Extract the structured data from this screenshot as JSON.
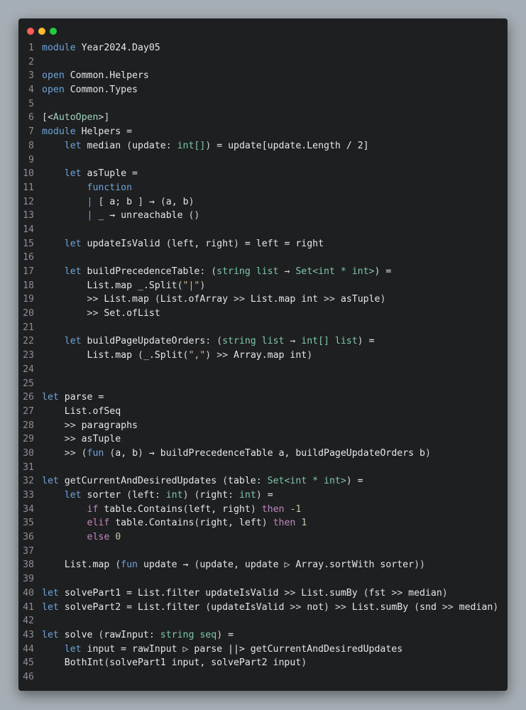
{
  "window": {
    "controls": [
      "close",
      "minimize",
      "zoom"
    ],
    "colors": {
      "background": "#1e1f21",
      "keyword": "#6fa3d8",
      "type": "#7fc8a9",
      "string": "#d8b486",
      "control": "#c586c0"
    }
  },
  "code": {
    "language": "fsharp",
    "lines": [
      [
        [
          "kw",
          "module"
        ],
        [
          "id",
          " Year2024.Day05"
        ]
      ],
      [],
      [
        [
          "kw",
          "open"
        ],
        [
          "id",
          " Common.Helpers"
        ]
      ],
      [
        [
          "kw",
          "open"
        ],
        [
          "id",
          " Common.Types"
        ]
      ],
      [],
      [
        [
          "op",
          "[<"
        ],
        [
          "at",
          "AutoOpen"
        ],
        [
          "op",
          ">]"
        ]
      ],
      [
        [
          "kw",
          "module"
        ],
        [
          "id",
          " Helpers ="
        ]
      ],
      [
        [
          "id",
          "    "
        ],
        [
          "kw",
          "let"
        ],
        [
          "id",
          " median "
        ],
        [
          "op",
          "("
        ],
        [
          "id",
          "update"
        ],
        [
          "op",
          ": "
        ],
        [
          "ty",
          "int[]"
        ],
        [
          "op",
          ")"
        ],
        [
          "id",
          " = update[update.Length / 2]"
        ]
      ],
      [],
      [
        [
          "id",
          "    "
        ],
        [
          "kw",
          "let"
        ],
        [
          "id",
          " asTuple ="
        ]
      ],
      [
        [
          "id",
          "        "
        ],
        [
          "kw",
          "function"
        ]
      ],
      [
        [
          "id",
          "        "
        ],
        [
          "kw",
          "|"
        ],
        [
          "id",
          " "
        ],
        [
          "op",
          "[ "
        ],
        [
          "id",
          "a"
        ],
        [
          "op",
          "; "
        ],
        [
          "id",
          "b"
        ],
        [
          "op",
          " ]"
        ],
        [
          "id",
          " → "
        ],
        [
          "op",
          "("
        ],
        [
          "id",
          "a, b"
        ],
        [
          "op",
          ")"
        ]
      ],
      [
        [
          "id",
          "        "
        ],
        [
          "kw",
          "|"
        ],
        [
          "id",
          " _ → unreachable "
        ],
        [
          "op",
          "()"
        ]
      ],
      [],
      [
        [
          "id",
          "    "
        ],
        [
          "kw",
          "let"
        ],
        [
          "id",
          " updateIsValid "
        ],
        [
          "op",
          "("
        ],
        [
          "id",
          "left, right"
        ],
        [
          "op",
          ")"
        ],
        [
          "id",
          " = left = right"
        ]
      ],
      [],
      [
        [
          "id",
          "    "
        ],
        [
          "kw",
          "let"
        ],
        [
          "id",
          " buildPrecedenceTable"
        ],
        [
          "op",
          ": ("
        ],
        [
          "ty",
          "string list"
        ],
        [
          "op",
          " → "
        ],
        [
          "ty",
          "Set<int * int>"
        ],
        [
          "op",
          ")"
        ],
        [
          "id",
          " ="
        ]
      ],
      [
        [
          "id",
          "        List.map _.Split"
        ],
        [
          "op",
          "("
        ],
        [
          "st",
          "\"|\""
        ],
        [
          "op",
          ")"
        ]
      ],
      [
        [
          "id",
          "        "
        ],
        [
          "op",
          ">>"
        ],
        [
          "id",
          " List.map "
        ],
        [
          "op",
          "("
        ],
        [
          "id",
          "List.ofArray "
        ],
        [
          "op",
          ">>"
        ],
        [
          "id",
          " List.map int "
        ],
        [
          "op",
          ">>"
        ],
        [
          "id",
          " asTuple"
        ],
        [
          "op",
          ")"
        ]
      ],
      [
        [
          "id",
          "        "
        ],
        [
          "op",
          ">>"
        ],
        [
          "id",
          " Set.ofList"
        ]
      ],
      [],
      [
        [
          "id",
          "    "
        ],
        [
          "kw",
          "let"
        ],
        [
          "id",
          " buildPageUpdateOrders"
        ],
        [
          "op",
          ": ("
        ],
        [
          "ty",
          "string list"
        ],
        [
          "op",
          " → "
        ],
        [
          "ty",
          "int[] list"
        ],
        [
          "op",
          ")"
        ],
        [
          "id",
          " ="
        ]
      ],
      [
        [
          "id",
          "        List.map "
        ],
        [
          "op",
          "("
        ],
        [
          "id",
          "_.Split"
        ],
        [
          "op",
          "("
        ],
        [
          "st",
          "\",\""
        ],
        [
          "op",
          ")"
        ],
        [
          "op",
          " >> "
        ],
        [
          "id",
          "Array.map int"
        ],
        [
          "op",
          ")"
        ]
      ],
      [],
      [],
      [
        [
          "kw",
          "let"
        ],
        [
          "id",
          " parse ="
        ]
      ],
      [
        [
          "id",
          "    List.ofSeq"
        ]
      ],
      [
        [
          "id",
          "    "
        ],
        [
          "op",
          ">>"
        ],
        [
          "id",
          " paragraphs"
        ]
      ],
      [
        [
          "id",
          "    "
        ],
        [
          "op",
          ">>"
        ],
        [
          "id",
          " asTuple"
        ]
      ],
      [
        [
          "id",
          "    "
        ],
        [
          "op",
          ">> ("
        ],
        [
          "kw",
          "fun"
        ],
        [
          "id",
          " "
        ],
        [
          "op",
          "("
        ],
        [
          "id",
          "a, b"
        ],
        [
          "op",
          ")"
        ],
        [
          "id",
          " → buildPrecedenceTable a, buildPageUpdateOrders b"
        ],
        [
          "op",
          ")"
        ]
      ],
      [],
      [
        [
          "kw",
          "let"
        ],
        [
          "id",
          " getCurrentAndDesiredUpdates "
        ],
        [
          "op",
          "("
        ],
        [
          "id",
          "table"
        ],
        [
          "op",
          ": "
        ],
        [
          "ty",
          "Set<int * int>"
        ],
        [
          "op",
          ")"
        ],
        [
          "id",
          " ="
        ]
      ],
      [
        [
          "id",
          "    "
        ],
        [
          "kw",
          "let"
        ],
        [
          "id",
          " sorter "
        ],
        [
          "op",
          "("
        ],
        [
          "id",
          "left"
        ],
        [
          "op",
          ": "
        ],
        [
          "ty",
          "int"
        ],
        [
          "op",
          ") ("
        ],
        [
          "id",
          "right"
        ],
        [
          "op",
          ": "
        ],
        [
          "ty",
          "int"
        ],
        [
          "op",
          ")"
        ],
        [
          "id",
          " ="
        ]
      ],
      [
        [
          "id",
          "        "
        ],
        [
          "kw2",
          "if"
        ],
        [
          "id",
          " table.Contains"
        ],
        [
          "op",
          "("
        ],
        [
          "id",
          "left, right"
        ],
        [
          "op",
          ")"
        ],
        [
          "id",
          " "
        ],
        [
          "kw2",
          "then"
        ],
        [
          "id",
          " "
        ],
        [
          "num",
          "-1"
        ]
      ],
      [
        [
          "id",
          "        "
        ],
        [
          "kw2",
          "elif"
        ],
        [
          "id",
          " table.Contains"
        ],
        [
          "op",
          "("
        ],
        [
          "id",
          "right, left"
        ],
        [
          "op",
          ")"
        ],
        [
          "id",
          " "
        ],
        [
          "kw2",
          "then"
        ],
        [
          "id",
          " "
        ],
        [
          "num",
          "1"
        ]
      ],
      [
        [
          "id",
          "        "
        ],
        [
          "kw2",
          "else"
        ],
        [
          "id",
          " "
        ],
        [
          "num",
          "0"
        ]
      ],
      [],
      [
        [
          "id",
          "    List.map "
        ],
        [
          "op",
          "("
        ],
        [
          "kw",
          "fun"
        ],
        [
          "id",
          " update → "
        ],
        [
          "op",
          "("
        ],
        [
          "id",
          "update, update ▷ Array.sortWith sorter"
        ],
        [
          "op",
          "))"
        ]
      ],
      [],
      [
        [
          "kw",
          "let"
        ],
        [
          "id",
          " solvePart1 = List.filter updateIsValid "
        ],
        [
          "op",
          ">>"
        ],
        [
          "id",
          " List.sumBy "
        ],
        [
          "op",
          "("
        ],
        [
          "id",
          "fst "
        ],
        [
          "op",
          ">>"
        ],
        [
          "id",
          " median"
        ],
        [
          "op",
          ")"
        ]
      ],
      [
        [
          "kw",
          "let"
        ],
        [
          "id",
          " solvePart2 = List.filter "
        ],
        [
          "op",
          "("
        ],
        [
          "id",
          "updateIsValid "
        ],
        [
          "op",
          ">>"
        ],
        [
          "id",
          " not"
        ],
        [
          "op",
          ")"
        ],
        [
          "id",
          " "
        ],
        [
          "op",
          ">>"
        ],
        [
          "id",
          " List.sumBy "
        ],
        [
          "op",
          "("
        ],
        [
          "id",
          "snd "
        ],
        [
          "op",
          ">>"
        ],
        [
          "id",
          " median"
        ],
        [
          "op",
          ")"
        ]
      ],
      [],
      [
        [
          "kw",
          "let"
        ],
        [
          "id",
          " solve "
        ],
        [
          "op",
          "("
        ],
        [
          "id",
          "rawInput"
        ],
        [
          "op",
          ": "
        ],
        [
          "ty",
          "string seq"
        ],
        [
          "op",
          ")"
        ],
        [
          "id",
          " ="
        ]
      ],
      [
        [
          "id",
          "    "
        ],
        [
          "kw",
          "let"
        ],
        [
          "id",
          " input = rawInput ▷ parse ||> getCurrentAndDesiredUpdates"
        ]
      ],
      [
        [
          "id",
          "    BothInt"
        ],
        [
          "op",
          "("
        ],
        [
          "id",
          "solvePart1 input, solvePart2 input"
        ],
        [
          "op",
          ")"
        ]
      ],
      []
    ]
  }
}
